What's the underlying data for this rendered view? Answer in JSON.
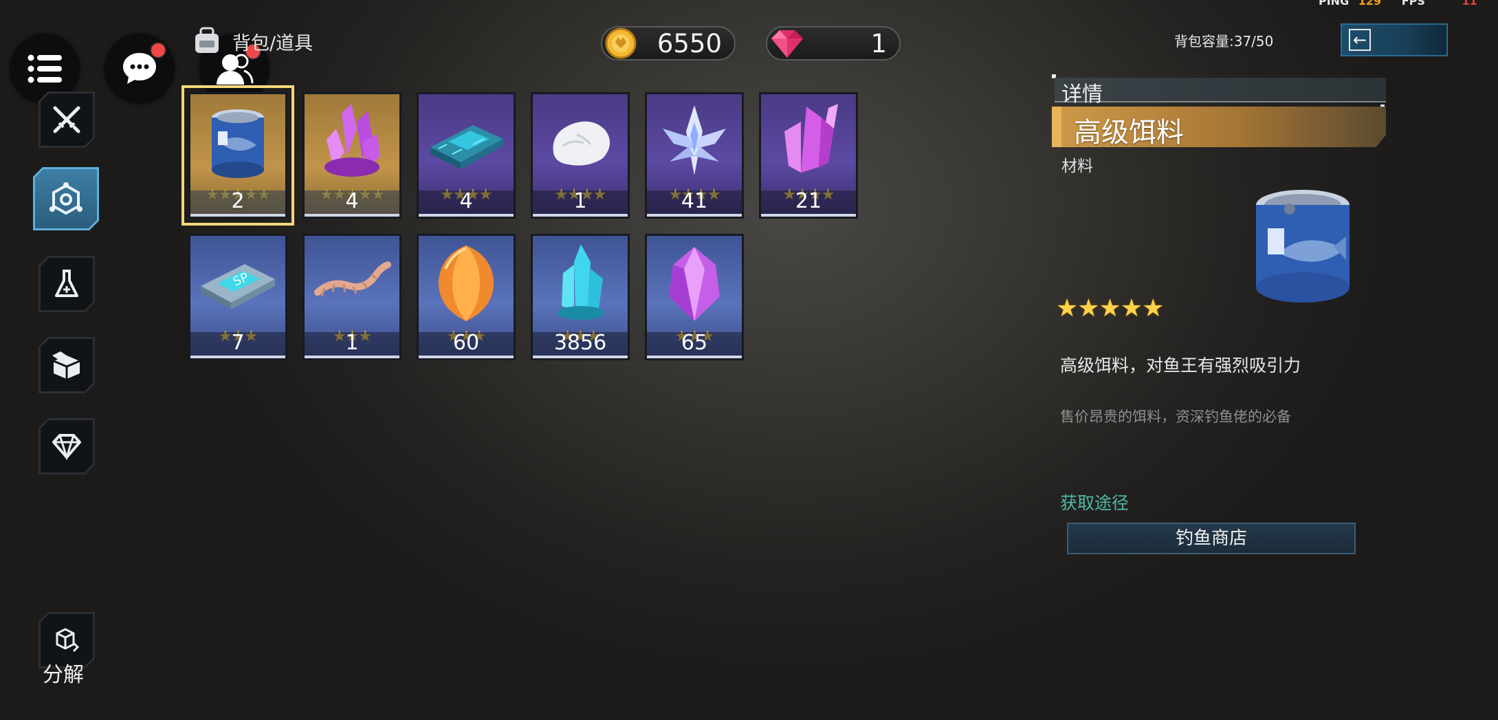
{
  "status_bar": {
    "ping_label": "PING",
    "ping_value": "129",
    "fps_label": "FPS",
    "fps_value": "11"
  },
  "header": {
    "title": "背包/道具",
    "capacity": "背包容量:37/50"
  },
  "currency": {
    "coins": "6550",
    "gems": "1"
  },
  "left_nav": {
    "items": [
      "sword-icon",
      "network-icon",
      "flask-icon",
      "box-icon",
      "diamond-icon"
    ],
    "decompose_label": "分解"
  },
  "inventory": {
    "items": [
      {
        "count": "2",
        "stars": "★★★★★",
        "rarity": "gold",
        "icon": "tin-can-icon",
        "selected": true
      },
      {
        "count": "4",
        "stars": "★★★★★",
        "rarity": "gold",
        "icon": "pink-crystal-cluster-icon"
      },
      {
        "count": "4",
        "stars": "★★★★",
        "rarity": "purple",
        "icon": "circuit-chip-icon"
      },
      {
        "count": "1",
        "stars": "★★★★",
        "rarity": "purple",
        "icon": "white-stone-icon"
      },
      {
        "count": "41",
        "stars": "★★★★",
        "rarity": "purple",
        "icon": "ice-crystal-icon"
      },
      {
        "count": "21",
        "stars": "★★★★",
        "rarity": "purple",
        "icon": "magenta-crystal-icon"
      },
      {
        "count": "7",
        "stars": "★★★",
        "rarity": "blue",
        "icon": "sp-chip-icon"
      },
      {
        "count": "1",
        "stars": "★★★",
        "rarity": "blue",
        "icon": "worm-bait-icon"
      },
      {
        "count": "60",
        "stars": "★★★",
        "rarity": "blue",
        "icon": "orange-gem-icon"
      },
      {
        "count": "3856",
        "stars": "★★★",
        "rarity": "blue",
        "icon": "cyan-crystal-icon"
      },
      {
        "count": "65",
        "stars": "★★★",
        "rarity": "blue",
        "icon": "violet-gem-icon"
      }
    ]
  },
  "details": {
    "section_title": "详情",
    "item_name": "高级饵料",
    "item_type": "材料",
    "stars": "★★★★★",
    "description": "高级饵料，对鱼王有强烈吸引力",
    "flavor_text": "售价昂贵的饵料，资深钓鱼佬的必备",
    "source_title": "获取途径",
    "source_button": "钓鱼商店"
  },
  "colors": {
    "gold_card": "#c1944a",
    "purple_card": "#5c49a3",
    "blue_card": "#5a73bb",
    "accent_teal": "#4fb8a8",
    "banner_gold": "#cf9a49"
  }
}
